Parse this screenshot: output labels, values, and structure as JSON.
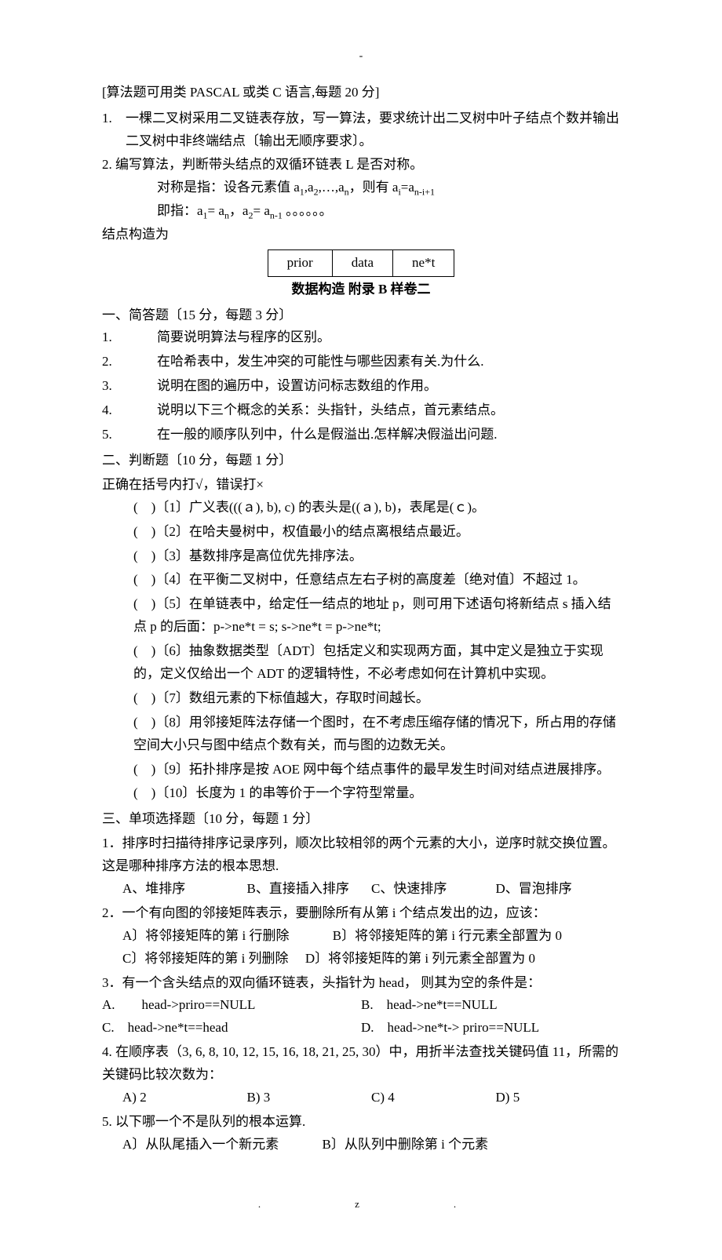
{
  "header_dash": "-",
  "algo_intro": "[算法题可用类 PASCAL 或类 C 语言,每题 20 分]",
  "algo_q1_num": "1.",
  "algo_q1": "一棵二叉树采用二叉链表存放，写一算法，要求统计出二叉树中叶子结点个数并输出二叉树中非终端结点〔输出无顺序要求〕。",
  "algo_q2_num": "2.",
  "algo_q2": "编写算法，判断带头结点的双循环链表 L 是否对称。",
  "algo_q2_line2_pre": "对称是指：设各元素值 a",
  "algo_q2_line2_mid": ",a",
  "algo_q2_line2_mid2": ",…,a",
  "algo_q2_line2_post": "，则有 a",
  "algo_q2_line2_eq": "=a",
  "algo_q2_line3_pre": "即指：a",
  "algo_q2_line3_eq1": "= a",
  "algo_q2_line3_sep": "，a",
  "algo_q2_line3_eq2": "= a",
  "algo_q2_line3_dots": " 。。。。。。",
  "node_struct_label": "结点构造为",
  "node_cells": {
    "c1": "prior",
    "c2": "data",
    "c3": "ne*t"
  },
  "appendix": "数据构造  附录 B    样卷二",
  "s1_title": "一、简答题〔15 分，每题 3 分〕",
  "s1": {
    "q1_num": "1.",
    "q1": "简要说明算法与程序的区别。",
    "q2_num": "2.",
    "q2": "在哈希表中，发生冲突的可能性与哪些因素有关.为什么.",
    "q3_num": "3.",
    "q3": "说明在图的遍历中，设置访问标志数组的作用。",
    "q4_num": "4.",
    "q4": "说明以下三个概念的关系：头指针，头结点，首元素结点。",
    "q5_num": "5.",
    "q5": "在一般的顺序队列中，什么是假溢出.怎样解决假溢出问题."
  },
  "s2_title": "二、判断题〔10 分，每题 1 分〕",
  "s2_intro": "正确在括号内打√，错误打×",
  "s2": {
    "q1": "(　)〔1〕广义表(((ａ), b), c) 的表头是((ａ), b)，表尾是(ｃ)。",
    "q2": "(　)〔2〕在哈夫曼树中，权值最小的结点离根结点最近。",
    "q3": "(　)〔3〕基数排序是高位优先排序法。",
    "q4": "(　)〔4〕在平衡二叉树中，任意结点左右子树的高度差〔绝对值〕不超过 1。",
    "q5": "(　)〔5〕在单链表中，给定任一结点的地址 p，则可用下述语句将新结点 s 插入结点 p 的后面：p->ne*t = s;   s->ne*t = p->ne*t;",
    "q6": "(　)〔6〕抽象数据类型〔ADT〕包括定义和实现两方面，其中定义是独立于实现的，定义仅给出一个 ADT 的逻辑特性，不必考虑如何在计算机中实现。",
    "q7": "(　)〔7〕数组元素的下标值越大，存取时间越长。",
    "q8": "(　)〔8〕用邻接矩阵法存储一个图时，在不考虑压缩存储的情况下，所占用的存储空间大小只与图中结点个数有关，而与图的边数无关。",
    "q9": "(　)〔9〕拓扑排序是按 AOE 网中每个结点事件的最早发生时间对结点进展排序。",
    "q10": "(　)〔10〕长度为 1 的串等价于一个字符型常量。"
  },
  "s3_title": "三、单项选择题〔10 分，每题 1 分〕",
  "s3": {
    "q1": "1．排序时扫描待排序记录序列，顺次比较相邻的两个元素的大小，逆序时就交换位置。这是哪种排序方法的根本思想.",
    "q1_opts": {
      "a": "A、堆排序",
      "b": "B、直接插入排序",
      "c": "C、快速排序",
      "d": "D、冒泡排序"
    },
    "q2": "2．一个有向图的邻接矩阵表示，要删除所有从第 i 个结点发出的边，应该：",
    "q2_l1a": "A〕将邻接矩阵的第 i 行删除",
    "q2_l1b": "B〕将邻接矩阵的第 i 行元素全部置为 0",
    "q2_l2a": "C〕将邻接矩阵的第 i 列删除",
    "q2_l2b": "D〕将邻接矩阵的第 i 列元素全部置为 0",
    "q3": "3．有一个含头结点的双向循环链表，头指针为 head， 则其为空的条件是：",
    "q3_l1a": "A.　　head->priro==NULL",
    "q3_l1b": "B.　head->ne*t==NULL",
    "q3_l2a": "C.　head->ne*t==head",
    "q3_l2b": "D.　head->ne*t-> priro==NULL",
    "q4": "4. 在顺序表（3, 6, 8, 10, 12, 15, 16, 18, 21, 25, 30）中，用折半法查找关键码值 11，所需的关键码比较次数为：",
    "q4_opts": {
      "a": "A) 2",
      "b": "B) 3",
      "c": "C) 4",
      "d": "D) 5"
    },
    "q5": "5. 以下哪一个不是队列的根本运算.",
    "q5_a": "A〕从队尾插入一个新元素",
    "q5_b": "B〕从队列中删除第 i 个元素"
  },
  "footer": {
    "dot": ".",
    "z": "z."
  }
}
